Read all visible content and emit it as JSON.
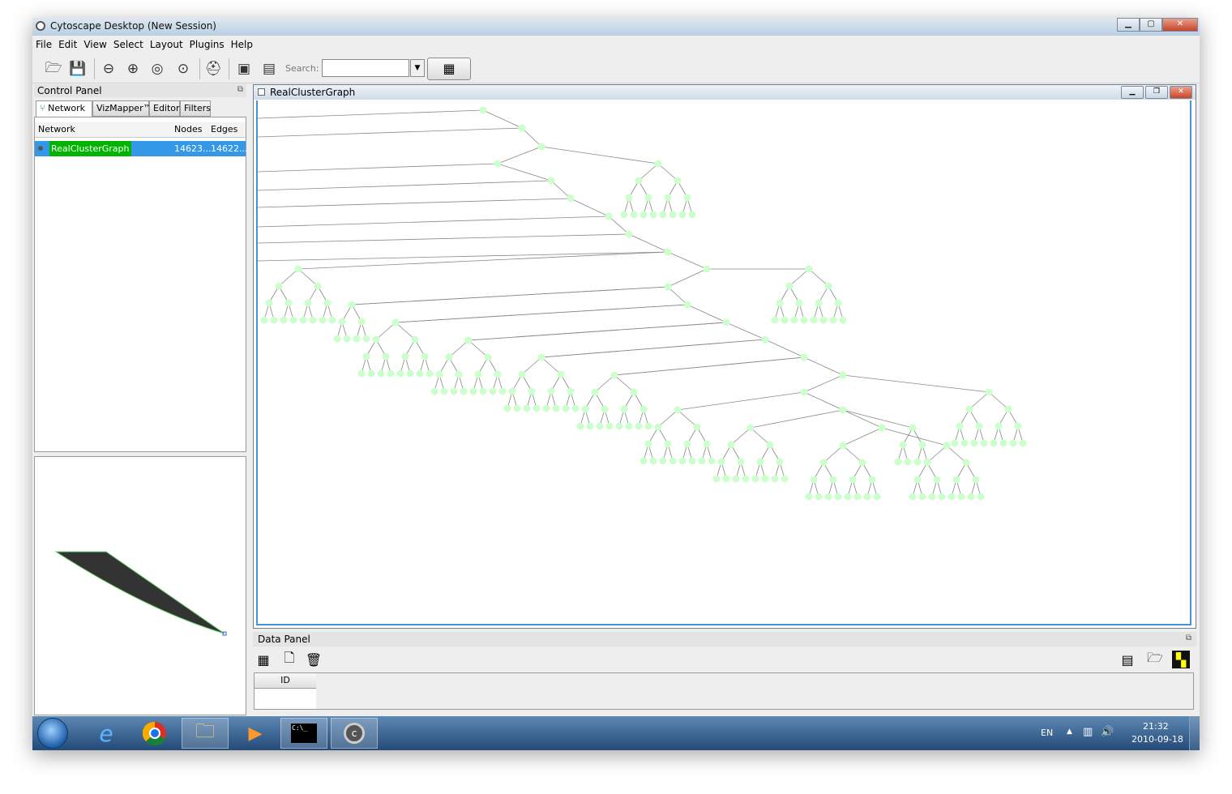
{
  "window": {
    "title": "Cytoscape Desktop (New Session)",
    "minimize": "▁",
    "maximize": "▢",
    "close": "✕"
  },
  "menu": [
    "File",
    "Edit",
    "View",
    "Select",
    "Layout",
    "Plugins",
    "Help"
  ],
  "toolbar": {
    "icons": [
      "open-icon",
      "save-icon",
      "zoom-out-icon",
      "zoom-in-icon",
      "zoom-selected-icon",
      "zoom-fit-icon",
      "help-icon",
      "new-network-icon",
      "vizmapper-icon",
      "search-config-icon"
    ],
    "search_label": "Search:",
    "search_value": ""
  },
  "control_panel": {
    "title": "Control Panel",
    "tabs": [
      "Network",
      "VizMapper™",
      "Editor",
      "Filters"
    ],
    "active_tab": "Network",
    "columns": [
      "Network",
      "Nodes",
      "Edges"
    ],
    "rows": [
      {
        "name": "RealClusterGraph",
        "nodes": "14623...",
        "edges": "14622..."
      }
    ]
  },
  "network_view": {
    "title": "RealClusterGraph",
    "node_color": "#ccffcc",
    "edge_color": "#888888",
    "selection_color": "#3398e8"
  },
  "data_panel": {
    "title": "Data Panel",
    "columns": [
      "ID"
    ]
  },
  "taskbar": {
    "apps": [
      "start-button",
      "ie-icon",
      "chrome-icon",
      "explorer-icon",
      "media-player-icon",
      "cmd-icon",
      "cytoscape-icon"
    ],
    "cmd_text": "C:\\_",
    "lang": "EN",
    "time": "21:32",
    "date": "2010-09-18"
  }
}
